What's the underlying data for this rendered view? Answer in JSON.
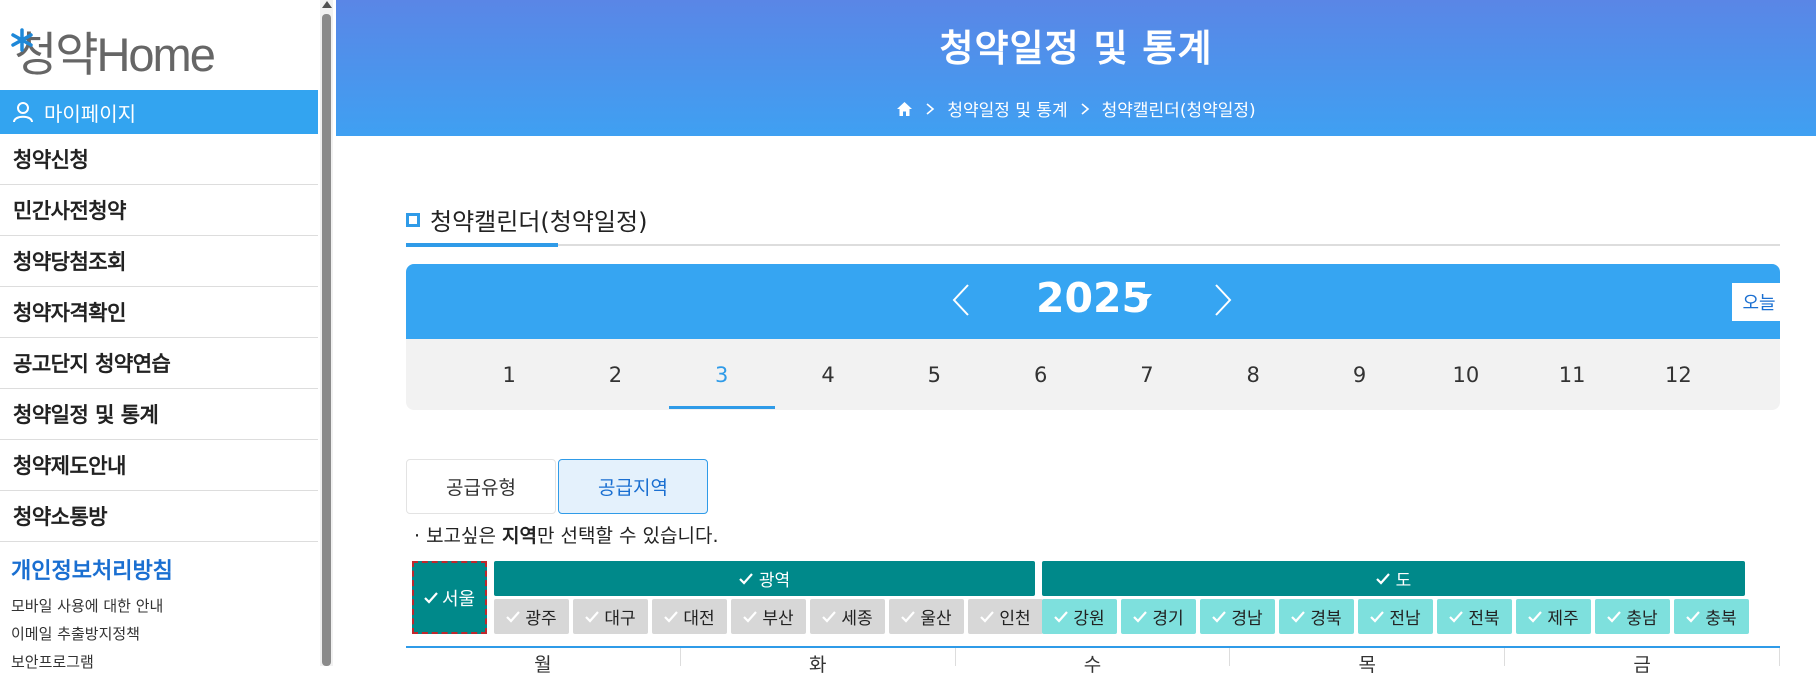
{
  "sidebar": {
    "logo_text": "청약Home",
    "mypage_label": "마이페이지",
    "menu": [
      "청약신청",
      "민간사전청약",
      "청약당첨조회",
      "청약자격확인",
      "공고단지 청약연습",
      "청약일정 및 통계",
      "청약제도안내",
      "청약소통방"
    ],
    "privacy_label": "개인정보처리방침",
    "sublinks": [
      "모바일 사용에 대한 안내",
      "이메일 추출방지정책",
      "보안프로그램"
    ]
  },
  "banner": {
    "title": "청약일정 및 통계",
    "breadcrumb": [
      "청약일정 및 통계",
      "청약캘린더(청약일정)"
    ]
  },
  "section": {
    "title": "청약캘린더(청약일정)"
  },
  "calendar": {
    "year": "2025",
    "today_label": "오늘",
    "months": [
      "1",
      "2",
      "3",
      "4",
      "5",
      "6",
      "7",
      "8",
      "9",
      "10",
      "11",
      "12"
    ],
    "selected_month": "3"
  },
  "filter": {
    "tabs": [
      "공급유형",
      "공급지역"
    ],
    "active_tab": "공급지역",
    "notice_prefix": "· 보고싶은 ",
    "notice_bold": "지역",
    "notice_suffix": "만 선택할 수 있습니다."
  },
  "regions": {
    "seoul": "서울",
    "metro_label": "광역",
    "metro": [
      "광주",
      "대구",
      "대전",
      "부산",
      "세종",
      "울산",
      "인천"
    ],
    "province_label": "도",
    "province": [
      "강원",
      "경기",
      "경남",
      "경북",
      "전남",
      "전북",
      "제주",
      "충남",
      "충북"
    ]
  },
  "weekdays": [
    "월",
    "화",
    "수",
    "목",
    "금"
  ],
  "colors": {
    "accent": "#2f9be8",
    "teal": "#00898a",
    "teal_light": "#7ee0dd",
    "chip_gray": "#d7d7d7"
  }
}
